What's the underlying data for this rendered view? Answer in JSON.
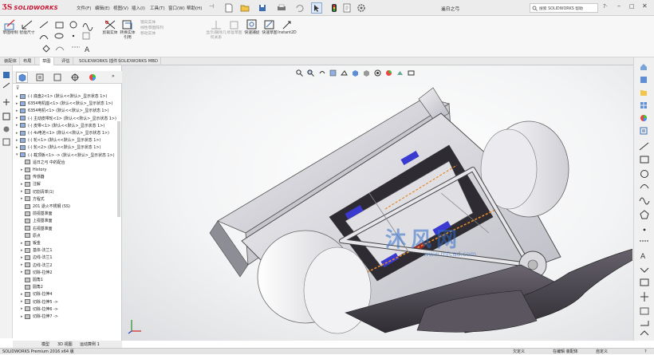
{
  "app": {
    "brand": "SOLIDWORKS",
    "document_title": "遥日之弓",
    "search_placeholder": "搜索 SOLIDWORKS 帮助"
  },
  "menu": [
    "文件(F)",
    "编辑(E)",
    "视图(V)",
    "插入(I)",
    "工具(T)",
    "窗口(W)",
    "帮助(H)"
  ],
  "command_manager": [
    {
      "label": "草图绘制",
      "icon": "sketch-icon"
    },
    {
      "label": "智能尺寸",
      "icon": "smart-dimension-icon"
    },
    {
      "label": "剪裁实体",
      "icon": "trim-icon"
    },
    {
      "label": "转换实体引用",
      "icon": "convert-entities-icon"
    },
    {
      "label": "等距实体",
      "icon": "offset-icon"
    },
    {
      "label": "镜向实体",
      "icon": "mirror-icon"
    },
    {
      "label": "线性草图阵列",
      "icon": "linear-pattern-icon"
    },
    {
      "label": "移动实体",
      "icon": "move-entities-icon"
    },
    {
      "label": "显示/删除几何关系",
      "icon": "relations-icon"
    },
    {
      "label": "修复草图",
      "icon": "repair-sketch-icon"
    },
    {
      "label": "快速捕捉",
      "icon": "quick-snap-icon"
    },
    {
      "label": "快速草图",
      "icon": "rapid-sketch-icon"
    },
    {
      "label": "Instant2D",
      "icon": "instant2d-icon"
    }
  ],
  "tabs": [
    "装配体",
    "布局",
    "草图",
    "评估",
    "SOLIDWORKS 插件",
    "SOLIDWORKS MBD"
  ],
  "active_tab": 2,
  "feature_tree": [
    {
      "exp": "▸",
      "text": "(-) 底盘2<1> (默认<<默认>_显示状态 1>)",
      "indent": 0
    },
    {
      "exp": "▸",
      "text": "6354电机座<1> (默认<<默认>_显示状态 1>)",
      "indent": 0
    },
    {
      "exp": "▸",
      "text": "6354电机<1> (默认<<默认>_显示状态 1>)",
      "indent": 0
    },
    {
      "exp": "▸",
      "text": "(-) 主动皮带轮<1> (默认<<默认>_显示状态 1>)",
      "indent": 0
    },
    {
      "exp": "▸",
      "text": "(-) 皮带<1> (默认<<默认>_显示状态 1>)",
      "indent": 0
    },
    {
      "exp": "▸",
      "text": "(-) 4s电池<1> (默认<<默认>_显示状态 1>)",
      "indent": 0
    },
    {
      "exp": "▸",
      "text": "(-) 轮<1> (默认<<默认>_显示状态 1>)",
      "indent": 0
    },
    {
      "exp": "▸",
      "text": "(-) 轮<2> (默认<<默认>_显示状态 1>)",
      "indent": 0
    },
    {
      "exp": "▾",
      "text": "(-) 截顶板<1> -> (默认<<默认>_显示状态 1>)",
      "indent": 0
    },
    {
      "exp": "",
      "text": "遥日之弓 中的配合",
      "indent": 1
    },
    {
      "exp": "▸",
      "text": "History",
      "indent": 1
    },
    {
      "exp": "",
      "text": "传感器",
      "indent": 1
    },
    {
      "exp": "▸",
      "text": "注解",
      "indent": 1
    },
    {
      "exp": "▸",
      "text": "切割清单(1)",
      "indent": 1
    },
    {
      "exp": "▸",
      "text": "方程式",
      "indent": 1
    },
    {
      "exp": "",
      "text": "201 退火不锈钢 (SS)",
      "indent": 1
    },
    {
      "exp": "",
      "text": "前视基准面",
      "indent": 1
    },
    {
      "exp": "",
      "text": "上视基准面",
      "indent": 1
    },
    {
      "exp": "",
      "text": "右视基准面",
      "indent": 1
    },
    {
      "exp": "",
      "text": "原点",
      "indent": 1
    },
    {
      "exp": "▸",
      "text": "钣金",
      "indent": 1
    },
    {
      "exp": "▸",
      "text": "基体-法兰1",
      "indent": 1
    },
    {
      "exp": "▸",
      "text": "边线-法兰1",
      "indent": 1
    },
    {
      "exp": "▸",
      "text": "边线-法兰2",
      "indent": 1
    },
    {
      "exp": "▸",
      "text": "切除-拉伸2",
      "indent": 1
    },
    {
      "exp": "",
      "text": "圆角1",
      "indent": 1
    },
    {
      "exp": "",
      "text": "圆角2",
      "indent": 1
    },
    {
      "exp": "▸",
      "text": "切除-拉伸4",
      "indent": 1
    },
    {
      "exp": "▸",
      "text": "切除-拉伸5 ->",
      "indent": 1
    },
    {
      "exp": "▸",
      "text": "切除-拉伸6 ->",
      "indent": 1
    },
    {
      "exp": "▸",
      "text": "切除-拉伸7 ->",
      "indent": 1
    }
  ],
  "bottom_tabs": [
    "模型",
    "3D 视图",
    "运动算例 1"
  ],
  "status": {
    "left": "SOLIDWORKS Premium 2016 x64 版",
    "center": "欠定义",
    "editing": "在编辑 装配体",
    "units": "自定义"
  },
  "watermark": {
    "text": "沐风网",
    "url": "www.mfcad.com"
  },
  "colors": {
    "accent": "#c8102e",
    "active_blue": "#2f6fc7",
    "plate": "#d9d9de"
  }
}
